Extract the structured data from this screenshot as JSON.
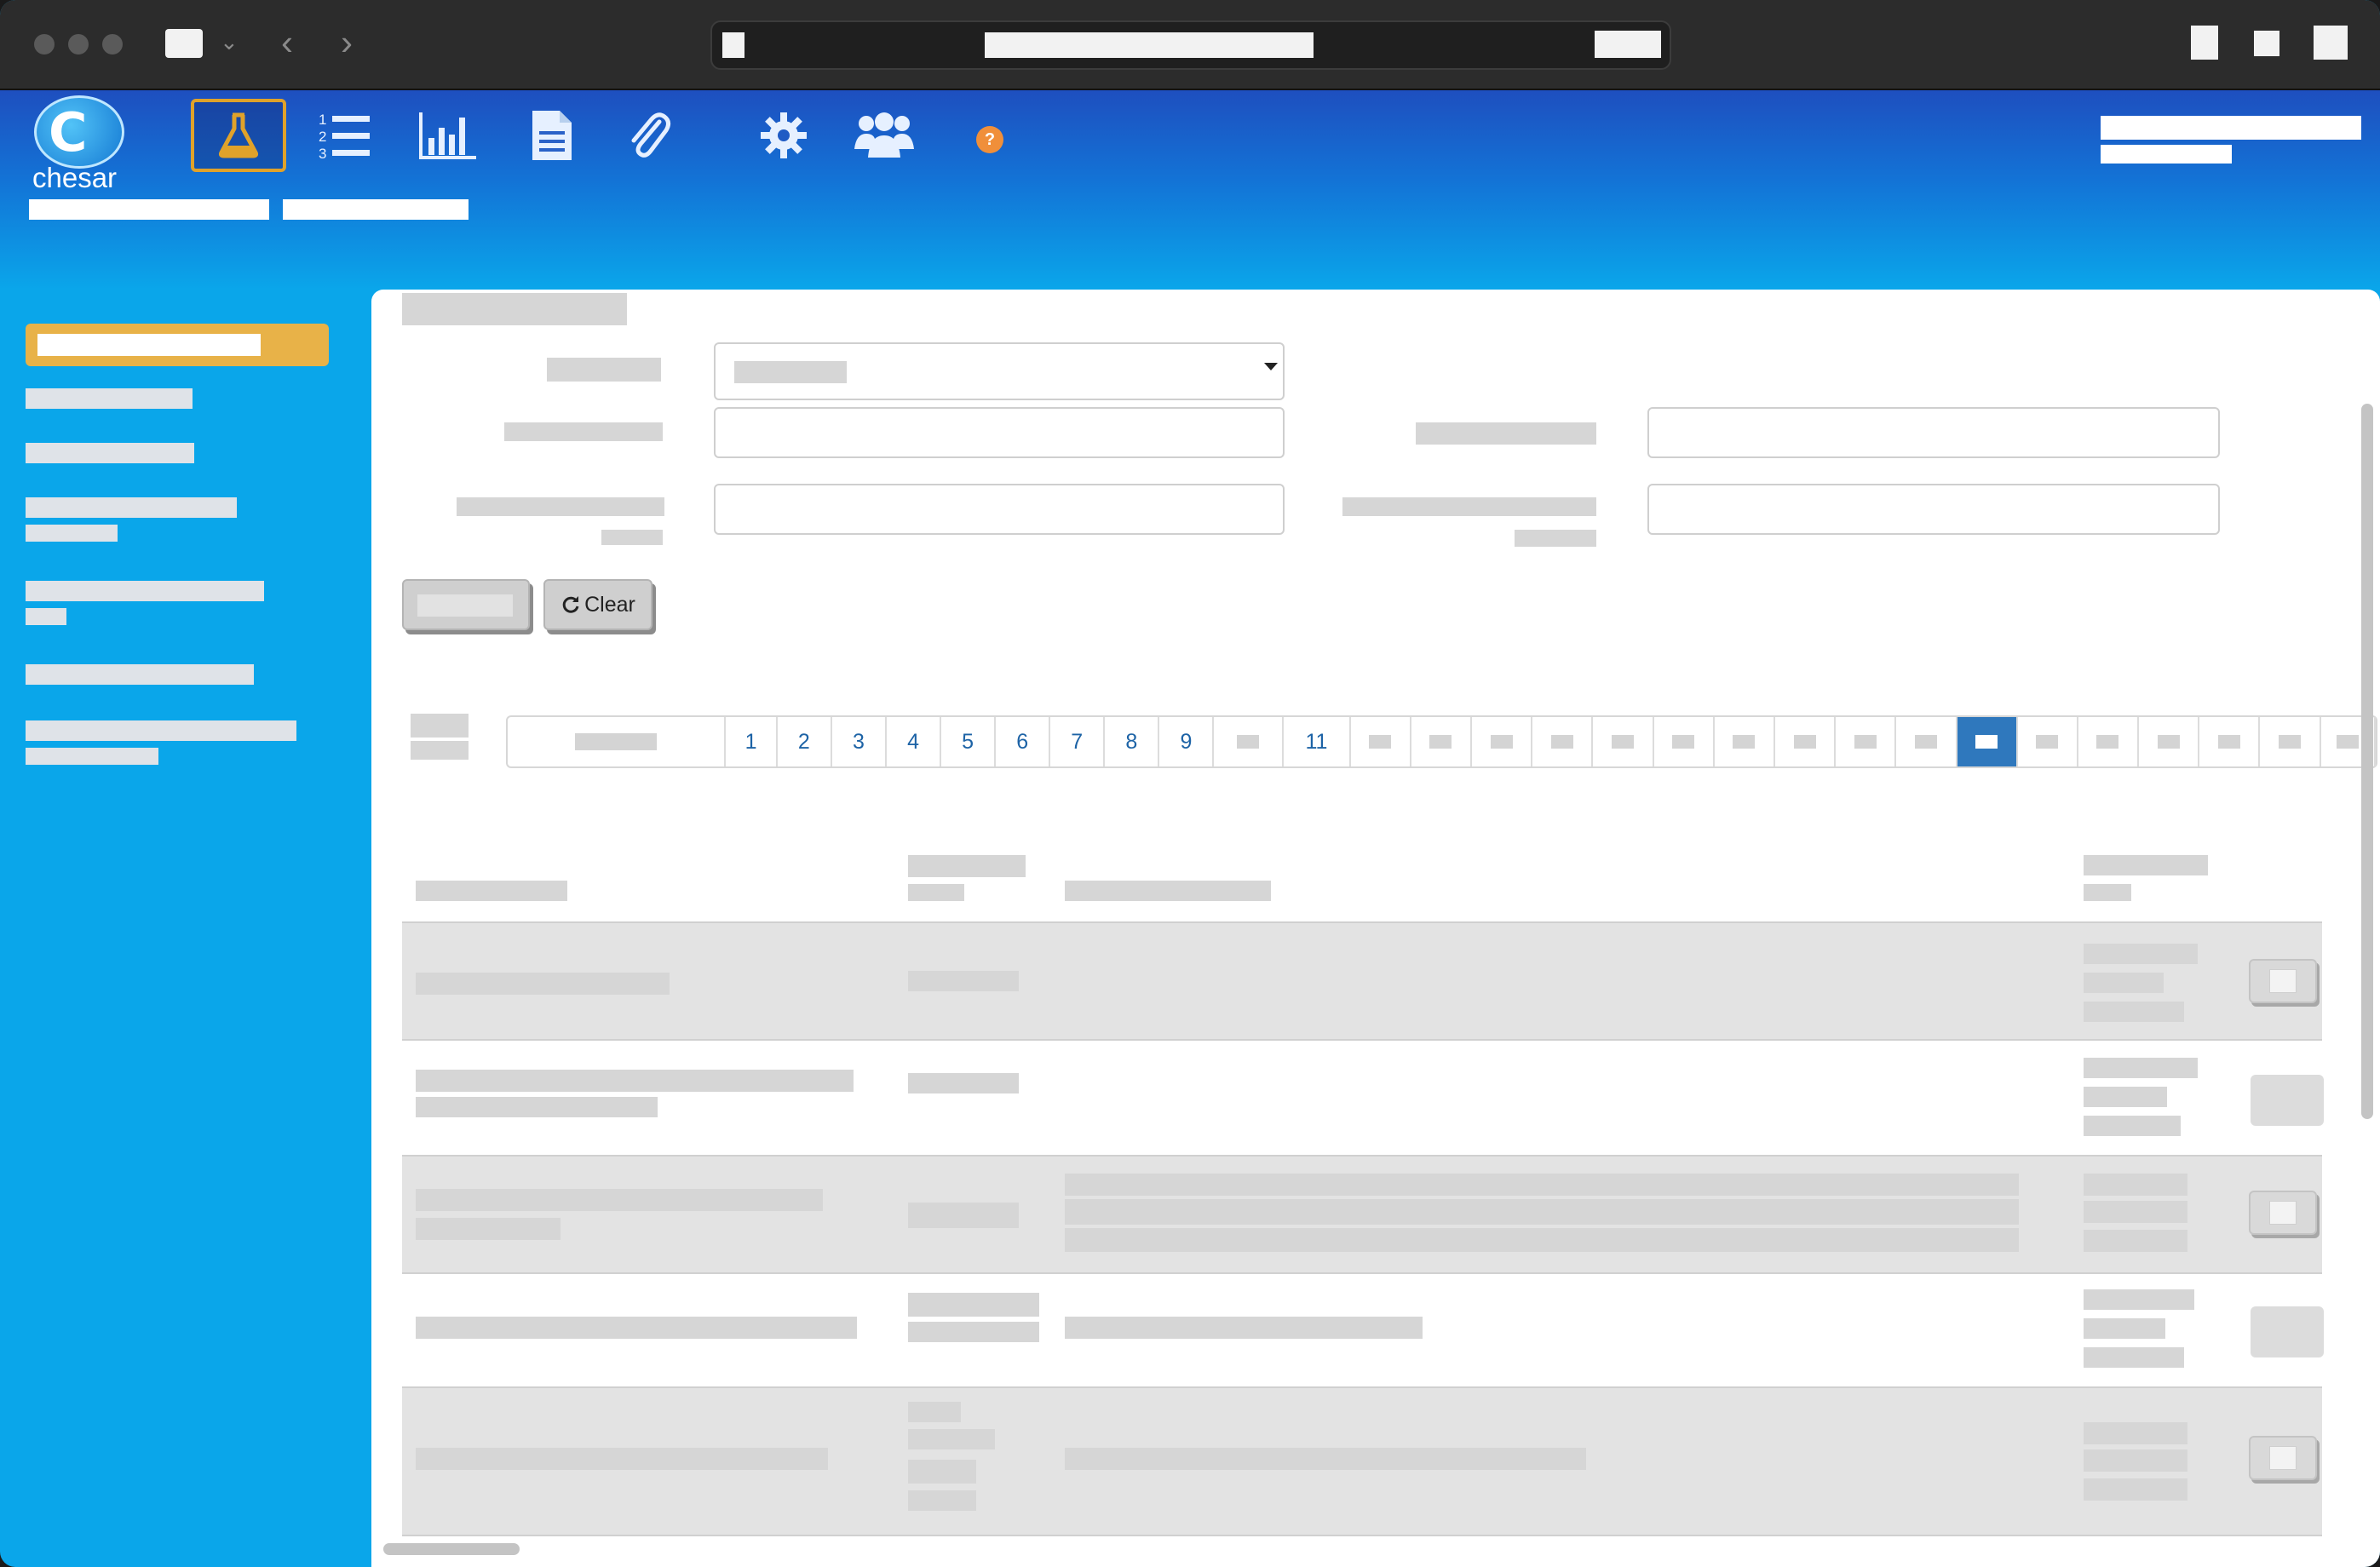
{
  "browser": {
    "nav_back": "‹",
    "nav_forward": "›",
    "tab_menu": "⌄"
  },
  "app": {
    "logo_text": "chesar",
    "logo_letter": "C",
    "nav_icons": [
      "flask-icon",
      "numbered-list-icon",
      "bar-chart-icon",
      "document-icon",
      "paperclip-icon",
      "gear-icon",
      "users-icon",
      "help-icon"
    ],
    "help_symbol": "?",
    "accent": "#e0a22a"
  },
  "search": {
    "clear_label": "Clear"
  },
  "pagination": {
    "pages": [
      "",
      "1",
      "2",
      "3",
      "4",
      "5",
      "6",
      "7",
      "8",
      "9",
      "",
      "11",
      "",
      "",
      "",
      "",
      "",
      "",
      "",
      "",
      "",
      "",
      "",
      "",
      "",
      "",
      "",
      "",
      ""
    ],
    "active_index": 22,
    "link_color": "#1d63a6",
    "active_color": "#2f78bd"
  },
  "colors": {
    "header_top": "#1e4fbf",
    "sidebar": "#0aa6ea",
    "active_menu": "#e8b248"
  }
}
